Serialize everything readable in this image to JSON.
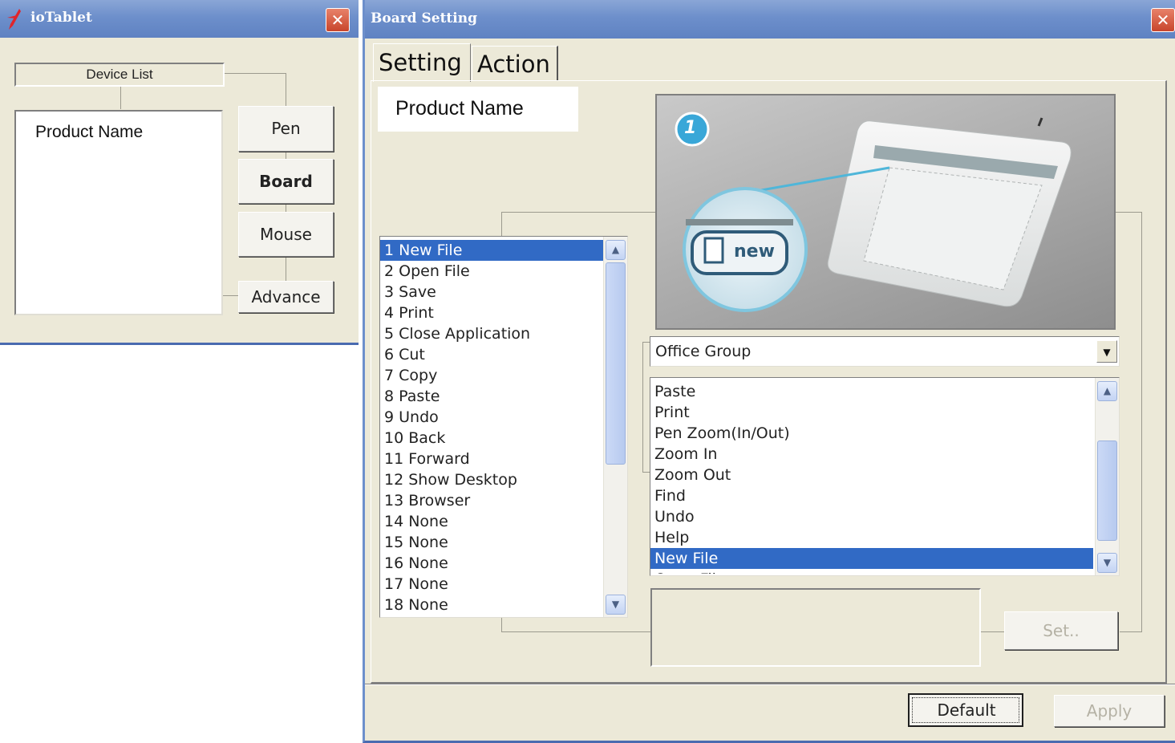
{
  "left_window": {
    "title": "ioTablet",
    "close_glyph": "✕",
    "device_list_label": "Device List",
    "device_items": [
      "Product Name"
    ],
    "nav_buttons": [
      "Pen",
      "Board",
      "Mouse",
      "Advance"
    ]
  },
  "board_window": {
    "title": "Board Setting",
    "close_glyph": "✕",
    "tabs": [
      "Setting",
      "Action"
    ],
    "product_name": "Product Name",
    "preview_badge": "1",
    "preview_key_label": "new",
    "key_list": [
      "1  New File",
      "2  Open File",
      "3  Save",
      "4  Print",
      "5  Close Application",
      "6  Cut",
      "7  Copy",
      "8  Paste",
      "9  Undo",
      "10 Back",
      "11 Forward",
      "12 Show Desktop",
      "13 Browser",
      "14 None",
      "15 None",
      "16 None",
      "17 None",
      "18 None"
    ],
    "key_list_selected": 0,
    "group_select_value": "Office Group",
    "action_list": [
      "Paste",
      "Print",
      "Pen Zoom(In/Out)",
      "Zoom In",
      "Zoom Out",
      "Find",
      "Undo",
      "Help",
      "New File",
      "Open File"
    ],
    "action_list_selected": 8,
    "set_button": "Set..",
    "default_button": "Default",
    "apply_button": "Apply"
  },
  "colors": {
    "selection": "#316ac5",
    "titlebar": "#6d8fcb",
    "window_bg": "#ece9d8"
  },
  "icons": {
    "app_icon": "red-pen-icon",
    "close": "close-icon",
    "scroll_up": "chevron-up-icon",
    "scroll_down": "chevron-down-icon",
    "dropdown": "dropdown-arrow-icon"
  }
}
